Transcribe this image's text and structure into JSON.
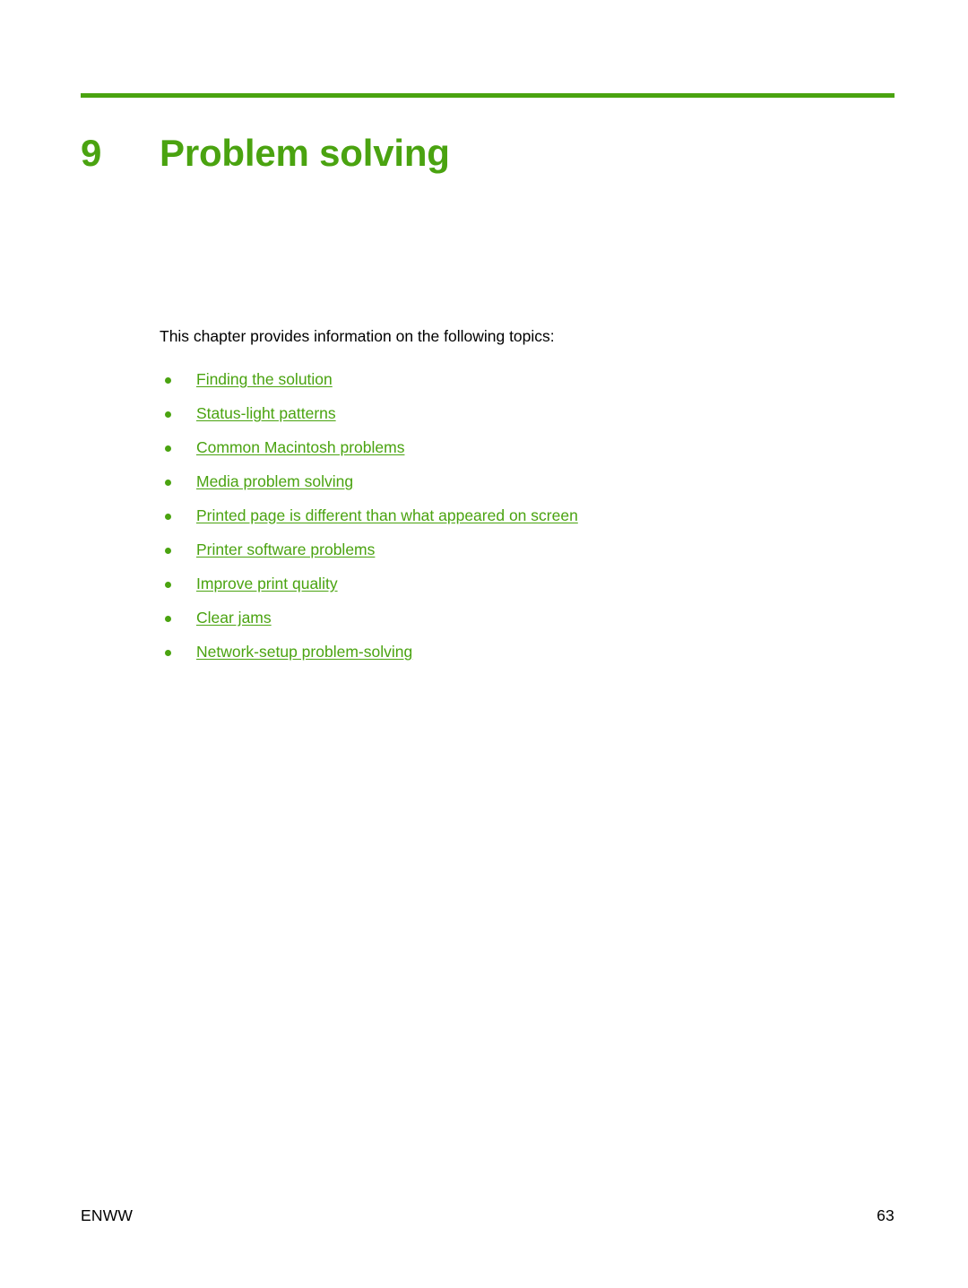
{
  "document": {
    "background_color": "#ffffff",
    "accent_color": "#4aa310",
    "text_color": "#000000"
  },
  "chapter": {
    "number": "9",
    "title": "Problem solving"
  },
  "body": {
    "intro": "This chapter provides information on the following topics:",
    "topics": [
      {
        "label": "Finding the solution"
      },
      {
        "label": "Status-light patterns"
      },
      {
        "label": "Common Macintosh problems"
      },
      {
        "label": "Media problem solving"
      },
      {
        "label": "Printed page is different than what appeared on screen"
      },
      {
        "label": "Printer software problems"
      },
      {
        "label": "Improve print quality"
      },
      {
        "label": "Clear jams"
      },
      {
        "label": "Network-setup problem-solving"
      }
    ]
  },
  "footer": {
    "left": "ENWW",
    "page_number": "63"
  }
}
